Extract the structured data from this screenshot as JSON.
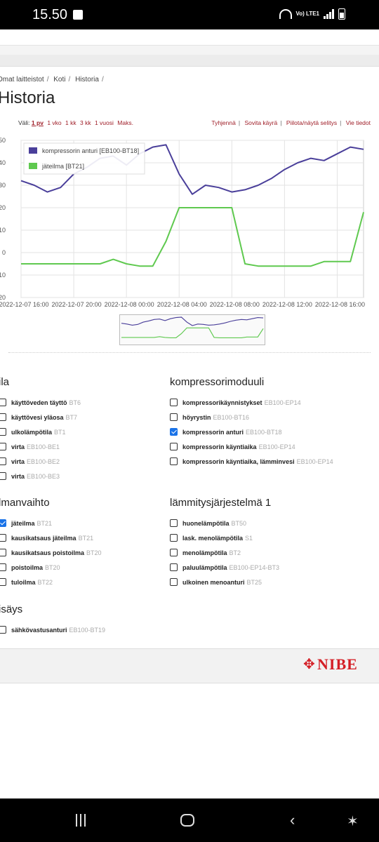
{
  "status_bar": {
    "time": "15.50",
    "network": "Vo) LTE1"
  },
  "breadcrumb": [
    "Omat laitteistot",
    "Koti",
    "Historia"
  ],
  "page_title": "Historia",
  "range": {
    "label": "Väli:",
    "options": [
      "1 pv",
      "1 vko",
      "1 kk",
      "3 kk",
      "1 vuosi",
      "Maks."
    ],
    "selected": "1 pv"
  },
  "actions": [
    "Tyhjennä",
    "Sovita käyrä",
    "Piilota/näytä selitys",
    "Vie tiedot"
  ],
  "chart_data": {
    "type": "line",
    "xlabel": "",
    "ylabel": "",
    "ylim": [
      -20,
      50
    ],
    "yticks": [
      "50",
      "40",
      "30",
      "20",
      "10",
      "0",
      "-10",
      "-20"
    ],
    "xticks": [
      "2022-12-07 16:00",
      "2022-12-07 20:00",
      "2022-12-08 00:00",
      "2022-12-08 04:00",
      "2022-12-08 08:00",
      "2022-12-08 12:00",
      "2022-12-08 16:00"
    ],
    "x_hours": [
      0,
      1,
      2,
      3,
      4,
      5,
      6,
      7,
      8,
      9,
      10,
      11,
      12,
      13,
      14,
      15,
      16,
      17,
      18,
      19,
      20,
      21,
      22,
      23,
      24,
      25,
      26
    ],
    "series": [
      {
        "name": "kompressorin anturi [EB100-BT18]",
        "color": "#4a3f9a",
        "values": [
          32,
          30,
          27,
          29,
          35,
          38,
          42,
          43,
          39,
          44,
          47,
          48,
          35,
          26,
          30,
          29,
          27,
          28,
          30,
          33,
          37,
          40,
          42,
          41,
          44,
          47,
          46
        ]
      },
      {
        "name": "jäteilma [BT21]",
        "color": "#5fc94f",
        "values": [
          -5,
          -5,
          -5,
          -5,
          -5,
          -5,
          -5,
          -3,
          -5,
          -6,
          -6,
          5,
          20,
          20,
          20,
          20,
          20,
          -5,
          -6,
          -6,
          -6,
          -6,
          -6,
          -4,
          -4,
          -4,
          18
        ]
      }
    ],
    "legend_position": "top-left",
    "grid": true
  },
  "groups": {
    "ila": {
      "title": "ila",
      "options": [
        {
          "name": "käyttöveden täyttö",
          "code": "BT6",
          "checked": false
        },
        {
          "name": "käyttövesi yläosa",
          "code": "BT7",
          "checked": false
        },
        {
          "name": "ulkolämpötila",
          "code": "BT1",
          "checked": false
        },
        {
          "name": "virta",
          "code": "EB100-BE1",
          "checked": false
        },
        {
          "name": "virta",
          "code": "EB100-BE2",
          "checked": false
        },
        {
          "name": "virta",
          "code": "EB100-BE3",
          "checked": false
        }
      ]
    },
    "kompressori": {
      "title": "kompressorimoduuli",
      "options": [
        {
          "name": "kompressorikäynnistykset",
          "code": "EB100-EP14",
          "checked": false
        },
        {
          "name": "höyrystin",
          "code": "EB100-BT16",
          "checked": false
        },
        {
          "name": "kompressorin anturi",
          "code": "EB100-BT18",
          "checked": true
        },
        {
          "name": "kompressorin käyntiaika",
          "code": "EB100-EP14",
          "checked": false
        },
        {
          "name": "kompressorin käyntiaika, lämminvesi",
          "code": "EB100-EP14",
          "checked": false
        }
      ]
    },
    "ilmanvaihto": {
      "title": "lmanvaihto",
      "options": [
        {
          "name": "jäteilma",
          "code": "BT21",
          "checked": true
        },
        {
          "name": "kausikatsaus jäteilma",
          "code": "BT21",
          "checked": false
        },
        {
          "name": "kausikatsaus poistoilma",
          "code": "BT20",
          "checked": false
        },
        {
          "name": "poistoilma",
          "code": "BT20",
          "checked": false
        },
        {
          "name": "tuloilma",
          "code": "BT22",
          "checked": false
        }
      ]
    },
    "lammitys": {
      "title": "lämmitysjärjestelmä 1",
      "options": [
        {
          "name": "huonelämpötila",
          "code": "BT50",
          "checked": false
        },
        {
          "name": "lask. menolämpötila",
          "code": "S1",
          "checked": false
        },
        {
          "name": "menolämpötila",
          "code": "BT2",
          "checked": false
        },
        {
          "name": "paluulämpötila",
          "code": "EB100-EP14-BT3",
          "checked": false
        },
        {
          "name": "ulkoinen menoanturi",
          "code": "BT25",
          "checked": false
        }
      ]
    },
    "lisays": {
      "title": "isäys",
      "options": [
        {
          "name": "sähkövastusanturi",
          "code": "EB100-BT19",
          "checked": false
        }
      ]
    }
  },
  "footer": {
    "brand": "NIBE"
  }
}
